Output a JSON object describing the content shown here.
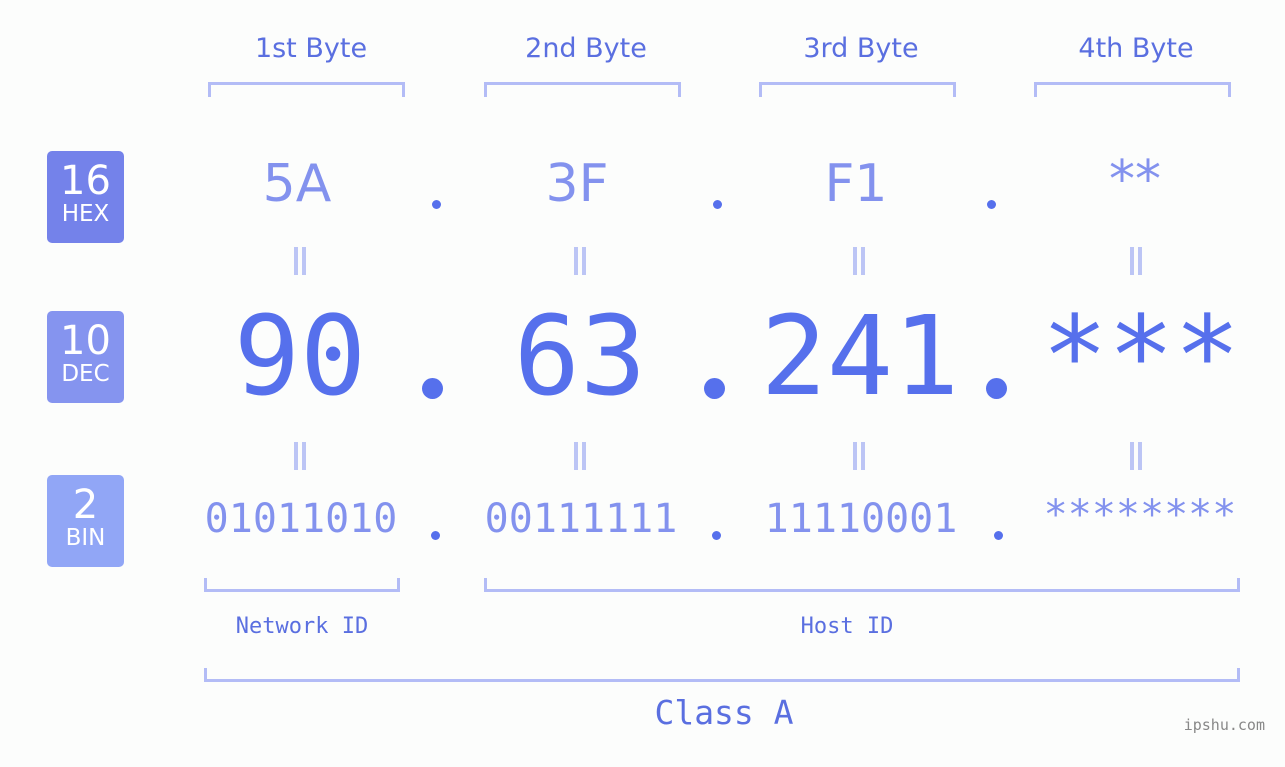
{
  "byte_headers": [
    "1st Byte",
    "2nd Byte",
    "3rd Byte",
    "4th Byte"
  ],
  "bases": [
    {
      "number": "16",
      "unit": "HEX",
      "color": "#7482ea"
    },
    {
      "number": "10",
      "unit": "DEC",
      "color": "#8594ef"
    },
    {
      "number": "2",
      "unit": "BIN",
      "color": "#91a6f6"
    }
  ],
  "hex": [
    "5A",
    "3F",
    "F1",
    "**"
  ],
  "dec": [
    "90",
    "63",
    "241",
    "***"
  ],
  "bin": [
    "01011010",
    "00111111",
    "11110001",
    "********"
  ],
  "sections": {
    "network_id": "Network ID",
    "host_id": "Host ID",
    "class": "Class A"
  },
  "watermark": "ipshu.com",
  "colors": {
    "primary": "#5670ec",
    "light": "#8392ee",
    "bracket": "#b3bcf6"
  }
}
